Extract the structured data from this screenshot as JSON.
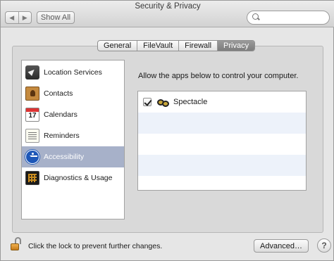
{
  "window": {
    "title": "Security & Privacy"
  },
  "toolbar": {
    "back_glyph": "◀",
    "forward_glyph": "▶",
    "show_all_label": "Show All",
    "search_placeholder": ""
  },
  "tabs": [
    {
      "label": "General",
      "selected": false
    },
    {
      "label": "FileVault",
      "selected": false
    },
    {
      "label": "Firewall",
      "selected": false
    },
    {
      "label": "Privacy",
      "selected": true
    }
  ],
  "sidebar": {
    "items": [
      {
        "label": "Location Services",
        "icon": "location-services-icon",
        "selected": false
      },
      {
        "label": "Contacts",
        "icon": "contacts-icon",
        "selected": false
      },
      {
        "label": "Calendars",
        "icon": "calendar-icon",
        "selected": false
      },
      {
        "label": "Reminders",
        "icon": "reminders-icon",
        "selected": false
      },
      {
        "label": "Accessibility",
        "icon": "accessibility-icon",
        "selected": true
      },
      {
        "label": "Diagnostics & Usage",
        "icon": "diagnostics-icon",
        "selected": false
      }
    ]
  },
  "main": {
    "instruction": "Allow the apps below to control your computer.",
    "apps": [
      {
        "name": "Spectacle",
        "checked": true,
        "icon": "spectacle-icon"
      }
    ]
  },
  "footer": {
    "lock_text": "Click the lock to prevent further changes.",
    "advanced_label": "Advanced…",
    "help_glyph": "?"
  },
  "colors": {
    "selection": "#a7b1c9",
    "selected_tab": "#8a8a8a",
    "alt_row": "#edf2fa"
  }
}
